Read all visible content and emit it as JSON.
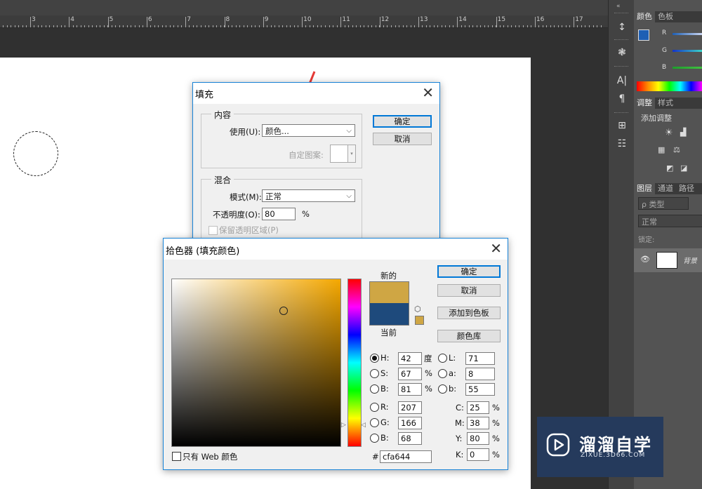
{
  "ruler": {
    "labels": [
      "3",
      "4",
      "5",
      "6",
      "7",
      "8",
      "9",
      "10",
      "11",
      "12",
      "13",
      "14",
      "15",
      "16",
      "17"
    ]
  },
  "toolstrip": {
    "icons": [
      "paragraph-styles-icon",
      "brush-icon",
      "character-icon",
      "paragraph-icon",
      "layout-icon",
      "notes-icon"
    ],
    "glyphs": [
      "↕",
      "❃",
      "A|",
      "¶",
      "⊞",
      "☷"
    ],
    "collapse": "«"
  },
  "panels": {
    "color_tabs": [
      "颜色",
      "色板"
    ],
    "color_channels": [
      "R",
      "G",
      "B"
    ],
    "adjust_tabs": [
      "调整",
      "样式"
    ],
    "adjust_add": "添加调整",
    "layer_tabs": [
      "图层",
      "通道",
      "路径"
    ],
    "layer_filter": "ρ 类型",
    "layer_blend": "正常",
    "layer_lock": "锁定:",
    "layer_name": "背景"
  },
  "fill_dialog": {
    "title": "填充",
    "content_group": "内容",
    "use_label": "使用(U):",
    "use_value": "颜色...",
    "pattern_label": "自定图案:",
    "blend_group": "混合",
    "mode_label": "模式(M):",
    "mode_value": "正常",
    "opacity_label": "不透明度(O):",
    "opacity_value": "80",
    "opacity_unit": "%",
    "preserve_label": "保留透明区域(P)",
    "ok": "确定",
    "cancel": "取消"
  },
  "picker": {
    "title": "拾色器 (填充颜色)",
    "new_label": "新的",
    "current_label": "当前",
    "new_color": "#cfa644",
    "current_color": "#1e4a7c",
    "hue_color": "#f5a800",
    "ok": "确定",
    "cancel": "取消",
    "add_swatch": "添加到色板",
    "libraries": "颜色库",
    "web_only": "只有 Web 颜色",
    "H": {
      "label": "H:",
      "value": "42",
      "unit": "度"
    },
    "S": {
      "label": "S:",
      "value": "67",
      "unit": "%"
    },
    "B": {
      "label": "B:",
      "value": "81",
      "unit": "%"
    },
    "R": {
      "label": "R:",
      "value": "207"
    },
    "G": {
      "label": "G:",
      "value": "166"
    },
    "B2": {
      "label": "B:",
      "value": "68"
    },
    "L": {
      "label": "L:",
      "value": "71"
    },
    "a": {
      "label": "a:",
      "value": "8"
    },
    "b": {
      "label": "b:",
      "value": "55"
    },
    "C": {
      "label": "C:",
      "value": "25",
      "unit": "%"
    },
    "M": {
      "label": "M:",
      "value": "38",
      "unit": "%"
    },
    "Y": {
      "label": "Y:",
      "value": "80",
      "unit": "%"
    },
    "K": {
      "label": "K:",
      "value": "0",
      "unit": "%"
    },
    "hex_label": "#",
    "hex_value": "cfa644"
  },
  "watermark": {
    "title": "溜溜自学",
    "url": "ZIXUE.3D66.COM"
  }
}
